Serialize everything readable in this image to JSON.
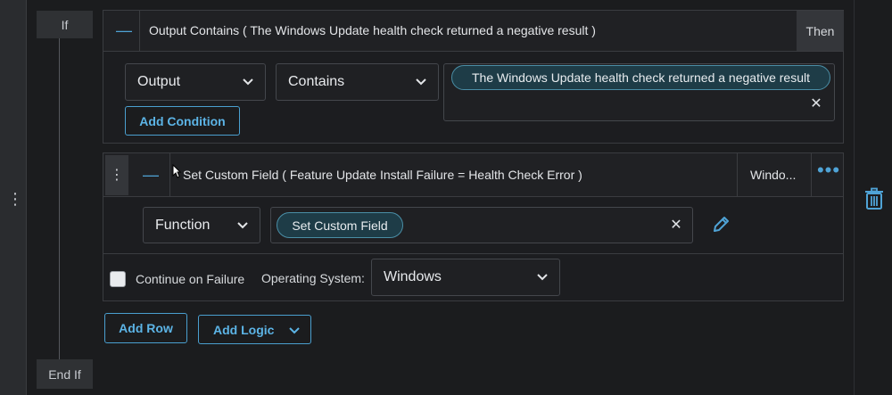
{
  "block": {
    "if_label": "If",
    "endif_label": "End If"
  },
  "condition": {
    "title": "Output Contains ( The Windows Update health check returned a negative result )",
    "then_label": "Then",
    "field_select": "Output",
    "operator_select": "Contains",
    "value_chip": "The Windows Update health check returned a negative result",
    "add_condition_label": "Add Condition"
  },
  "action": {
    "title": "Set Custom Field ( Feature Update Install Failure = Health Check Error )",
    "os_short": "Windo...",
    "function_select": "Function",
    "function_chip": "Set Custom Field",
    "continue_on_failure_label": "Continue on Failure",
    "continue_on_failure_checked": false,
    "os_label": "Operating System:",
    "os_select": "Windows"
  },
  "footer": {
    "add_row_label": "Add Row",
    "add_logic_label": "Add Logic"
  },
  "colors": {
    "accent": "#5cb4e6",
    "chip_bg": "#1e3c47",
    "chip_border": "#4a8ea6",
    "background": "#1b1c1e",
    "panel_border": "#3a3c40"
  },
  "icons": {
    "collapse": "minus-icon",
    "dropdown": "chevron-down-icon",
    "remove": "close-icon",
    "edit": "pencil-icon",
    "more": "more-horizontal-icon",
    "drag": "drag-handle-icon",
    "delete": "trash-icon"
  }
}
